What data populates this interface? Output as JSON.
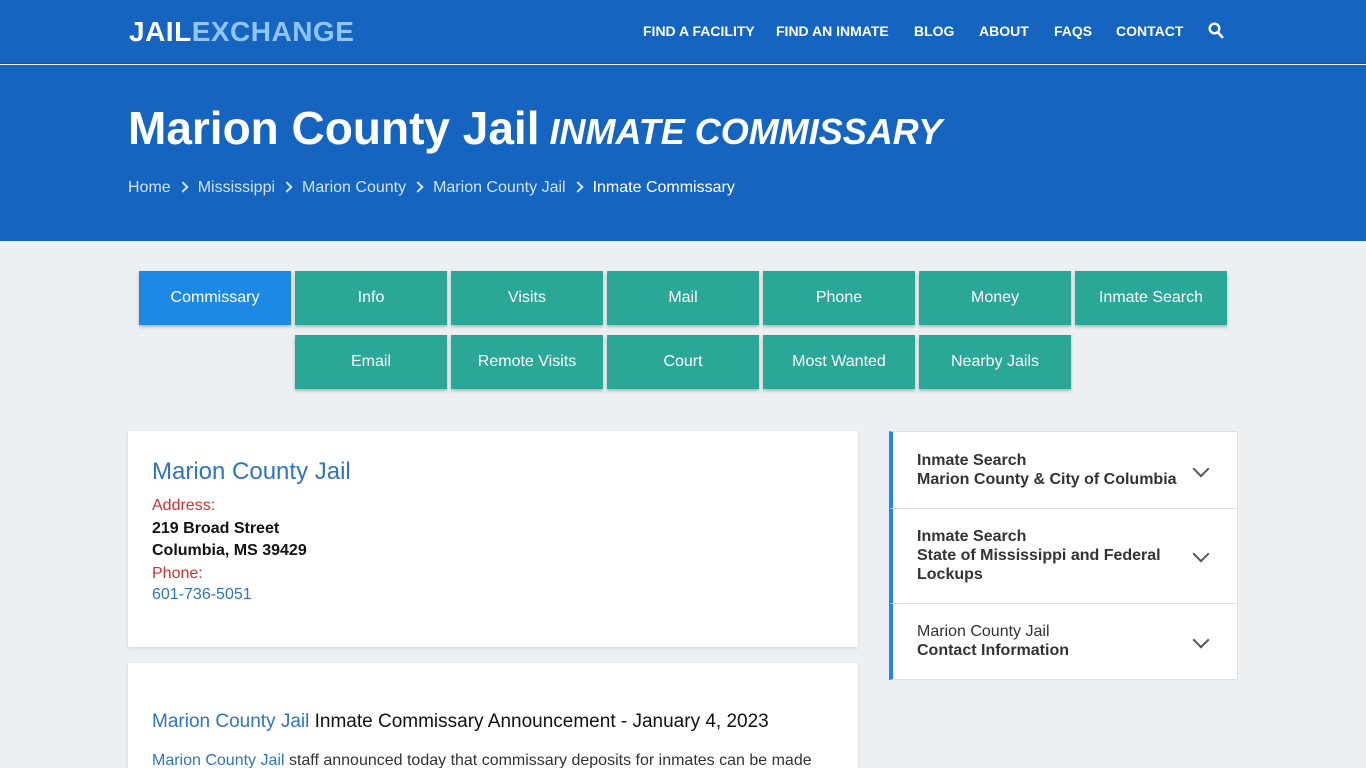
{
  "header": {
    "logo_part1": "JAIL",
    "logo_part2": "EXCHANGE",
    "nav": [
      "FIND A FACILITY",
      "FIND AN INMATE",
      "BLOG",
      "ABOUT",
      "FAQs",
      "CONTACT"
    ]
  },
  "hero": {
    "title": "Marion County Jail",
    "subtitle": "INMATE COMMISSARY",
    "breadcrumbs": [
      "Home",
      "Mississippi",
      "Marion County",
      "Marion County Jail",
      "Inmate Commissary"
    ]
  },
  "tabs": {
    "row1": [
      "Commissary",
      "Info",
      "Visits",
      "Mail",
      "Phone",
      "Money",
      "Inmate Search"
    ],
    "row2": [
      "Email",
      "Remote Visits",
      "Court",
      "Most Wanted",
      "Nearby Jails"
    ],
    "active": "Commissary"
  },
  "facility": {
    "name": "Marion County Jail",
    "address_label": "Address:",
    "address_line1": "219 Broad Street",
    "address_line2": "Columbia, MS 39429",
    "phone_label": "Phone:",
    "phone": "601-736-5051"
  },
  "announcement": {
    "link": "Marion County Jail",
    "heading": "Inmate Commissary Announcement - January 4, 2023",
    "body_link": "Marion County Jail",
    "body": "staff announced today that commissary deposits for inmates can be made"
  },
  "sidebar": {
    "items": [
      {
        "line1": "Inmate Search",
        "line2": "Marion County & City of Columbia"
      },
      {
        "line1": "Inmate Search",
        "line2": "State of Mississippi and Federal Lockups"
      },
      {
        "line1": "Marion County Jail",
        "line2": "Contact Information"
      }
    ]
  }
}
